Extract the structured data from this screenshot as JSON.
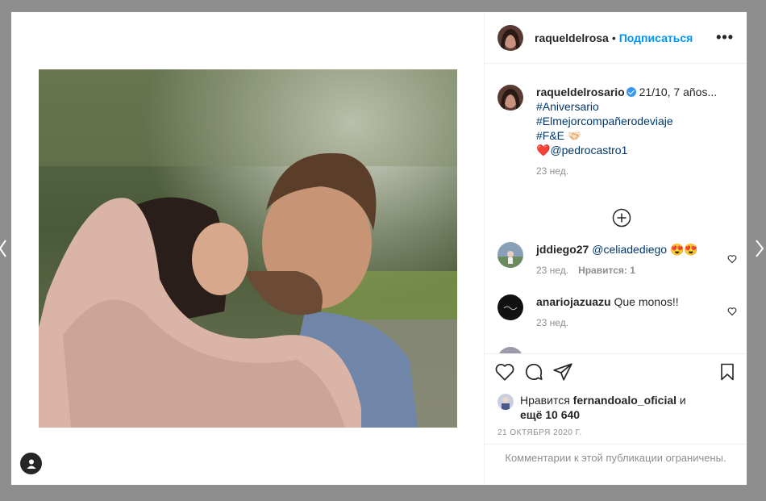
{
  "post": {
    "author": "raqueldelrosa",
    "dot": "•",
    "follow_label": "Подписаться",
    "more": "•••"
  },
  "caption": {
    "user": "raqueldelrosario",
    "text": "21/10, 7 años...",
    "lines": [
      "#Aniversario",
      "#Elmejorcompañerodeviaje",
      "#F&E 🤝🏻",
      "@pedrocastro1"
    ],
    "heart": "❤️",
    "time": "23 нед."
  },
  "comments": [
    {
      "user": "jddiego27",
      "mention": "@celiadediego",
      "text": " 😍😍",
      "time": "23 нед.",
      "likes": "Нравится: 1"
    },
    {
      "user": "anariojazuazu",
      "mention": "",
      "text": "Que monos!!",
      "time": "23 нед.",
      "likes": ""
    }
  ],
  "likes": {
    "prefix": "Нравится ",
    "user": "fernandoalo_oficial",
    "mid": " и",
    "rest": "ещё 10 640"
  },
  "date": "21 ОКТЯБРЯ 2020 Г.",
  "comments_limited": "Комментарии к этой публикации ограничены.",
  "icons": {
    "heart": "heart-icon",
    "comment": "comment-icon",
    "share": "share-icon",
    "save": "bookmark-icon",
    "load_more": "plus-circle-icon",
    "tag": "user-tag-icon",
    "next": "chevron-right-icon",
    "prev": "chevron-left-icon"
  },
  "colors": {
    "accent": "#0095f6",
    "link": "#00376b",
    "muted": "#8e8e8e",
    "verified": "#3897f0"
  }
}
